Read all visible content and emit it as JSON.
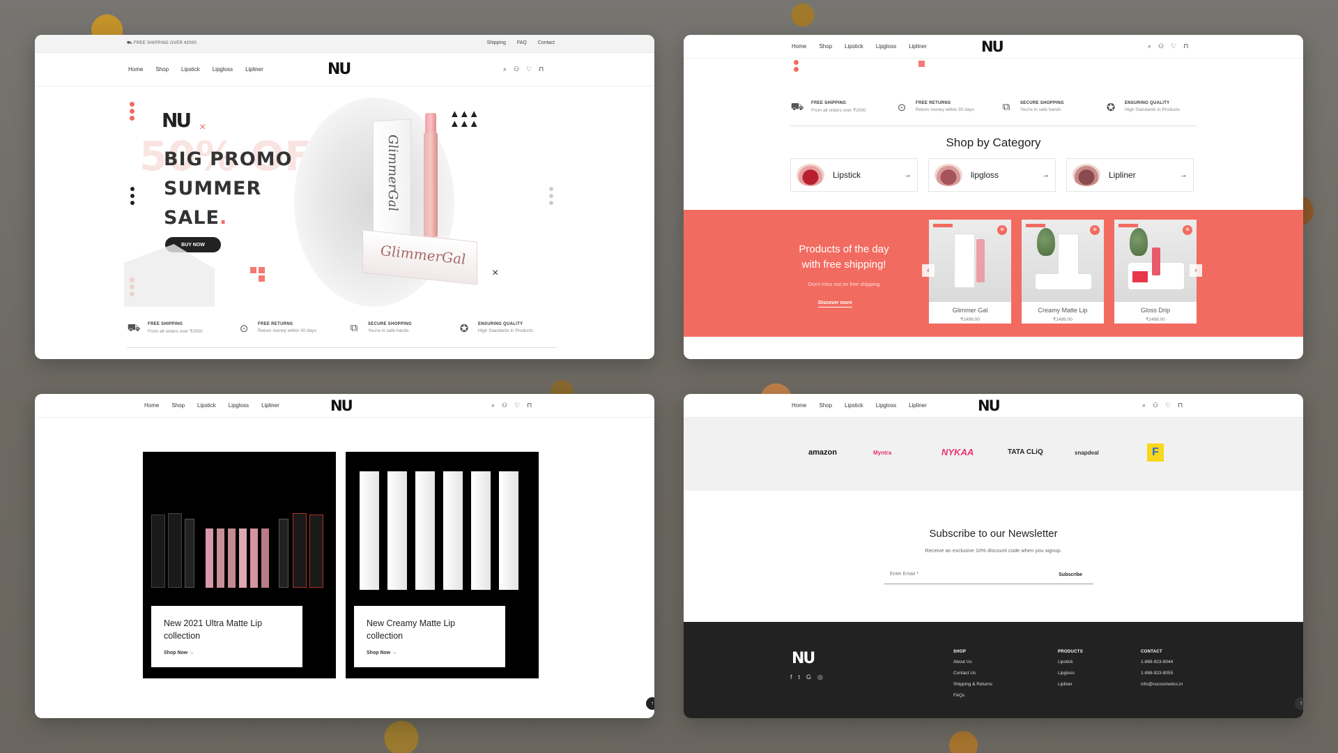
{
  "nav": {
    "links": [
      "Home",
      "Shop",
      "Lipstick",
      "Lipgloss",
      "Lipliner"
    ],
    "logo": "NU",
    "icons": [
      "search-icon",
      "user-icon",
      "heart-icon",
      "bag-icon"
    ]
  },
  "topbar": {
    "shipping": "FREE SHIPPING OVER ₹2000",
    "links": [
      "Shipping",
      "FAQ",
      "Contact"
    ]
  },
  "hero": {
    "ghost_text": "50% OFF",
    "logo": "NU",
    "title_lines": [
      "BIG PROMO",
      "SUMMER",
      "SALE"
    ],
    "button": "BUY NOW",
    "box_tall_text": "GlimmerGal",
    "box_low_text": "GlimmerGal"
  },
  "features": [
    {
      "title": "FREE SHIPPING",
      "sub": "From all orders over ₹2000",
      "icon": "truck-icon"
    },
    {
      "title": "FREE RETURNS",
      "sub": "Return money within 30 days",
      "icon": "money-icon"
    },
    {
      "title": "SECURE SHOPPING",
      "sub": "You're in safe hands",
      "icon": "box-icon"
    },
    {
      "title": "ENSURING QUALITY",
      "sub": "High Standards in Products",
      "icon": "award-icon"
    }
  ],
  "shop_by_category": {
    "title": "Shop by Category",
    "items": [
      "Lipstick",
      "lipgloss",
      "Lipliner"
    ]
  },
  "promo": {
    "title": "Products of the day with free shipping!",
    "sub": "Don't miss out on free shipping",
    "link": "Discover more",
    "products": [
      {
        "name": "Glimmer Gal",
        "price": "₹1499.00"
      },
      {
        "name": "Creamy Matte Lip",
        "price": "₹1499.00"
      },
      {
        "name": "Gloss Drip",
        "price": "₹1499.00"
      }
    ]
  },
  "collections": [
    {
      "title": "New 2021 Ultra Matte Lip collection",
      "link": "Shop Now →"
    },
    {
      "title": "New Creamy Matte Lip collection",
      "link": "Shop Now →"
    }
  ],
  "brands": [
    "amazon",
    "Myntra",
    "NYKAA",
    "TATA CLiQ",
    "snapdeal",
    "F"
  ],
  "newsletter": {
    "title": "Subscribe to our Newsletter",
    "sub": "Receive an exclusive 10% discount code when you signup.",
    "placeholder": "Enter Email *",
    "button": "Subscribe"
  },
  "footer": {
    "logo": "NU",
    "social": [
      "f",
      "t",
      "G",
      "◎"
    ],
    "shop": {
      "heading": "SHOP",
      "items": [
        "About Us",
        "Contact Us",
        "Shipping & Returns",
        "FAQs"
      ]
    },
    "products": {
      "heading": "PRODUCTS",
      "items": [
        "Lipstick",
        "Lipgloss",
        "Lipliner"
      ]
    },
    "contact": {
      "heading": "CONTACT",
      "items": [
        "1-888-923-8044",
        "1-888-923-8055",
        "info@nucosmetics.in"
      ]
    }
  },
  "colors": {
    "accent": "#f26b60",
    "dark": "#222222",
    "brand_gray": "#f1f1f1"
  }
}
